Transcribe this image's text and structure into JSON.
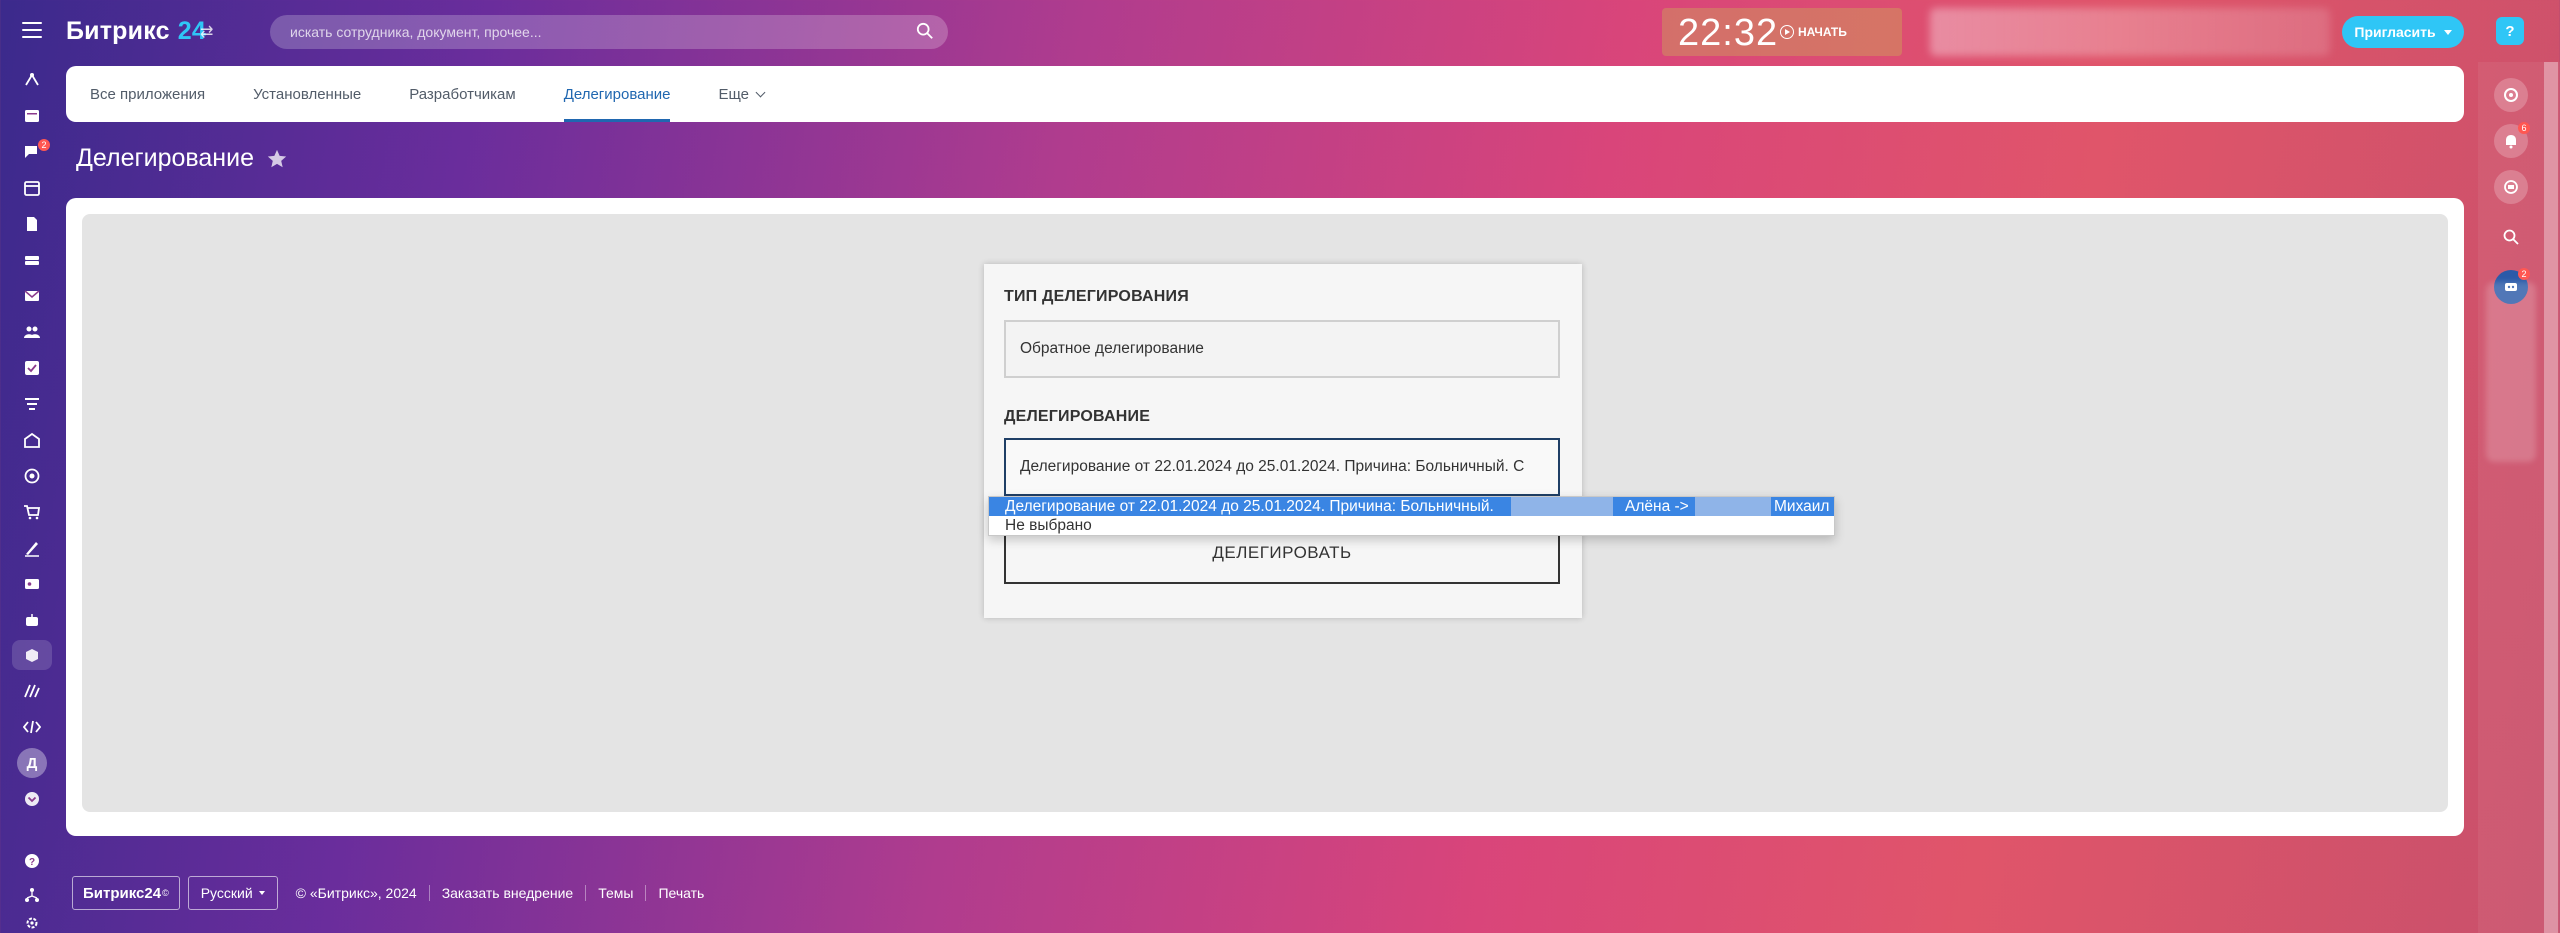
{
  "header": {
    "logo_text": "Битрикс",
    "logo_num": "24",
    "search_placeholder": "искать сотрудника, документ, прочее...",
    "clock": "22:32",
    "start_label": "НАЧАТЬ",
    "invite_label": "Пригласить",
    "help_label": "?"
  },
  "left_rail": {
    "chat_badge": "2",
    "avatar_letter": "Д"
  },
  "right_rail": {
    "bell_badge": "6",
    "group_badge": "2"
  },
  "tabs": [
    {
      "label": "Все приложения",
      "active": false
    },
    {
      "label": "Установленные",
      "active": false
    },
    {
      "label": "Разработчикам",
      "active": false
    },
    {
      "label": "Делегирование",
      "active": true
    },
    {
      "label": "Еще",
      "active": false
    }
  ],
  "page": {
    "title": "Делегирование"
  },
  "form": {
    "type_label": "Тип делегирования",
    "type_value": "Обратное делегирование",
    "delegation_label": "Делегирование",
    "delegation_value": "Делегирование от 22.01.2024 до 25.01.2024. Причина: Больничный. С",
    "button_label": "Делегировать",
    "options": [
      {
        "p1": "Делегирование от 22.01.2024 до 25.01.2024. Причина: Больничный.",
        "p2": "Алёна ->",
        "p3": "Михаил",
        "selected": true
      },
      {
        "p1": "Не выбрано",
        "selected": false
      }
    ]
  },
  "footer": {
    "brand": "Битрикс24",
    "brand_mark": "©",
    "language": "Русский",
    "copyright": "© «Битрикс», 2024",
    "links": [
      "Заказать внедрение",
      "Темы",
      "Печать"
    ]
  },
  "colors": {
    "accent": "#2fc6f6",
    "tab_active": "#2067b0",
    "option_selected": "#3a85e3",
    "badge": "#ff5752"
  }
}
